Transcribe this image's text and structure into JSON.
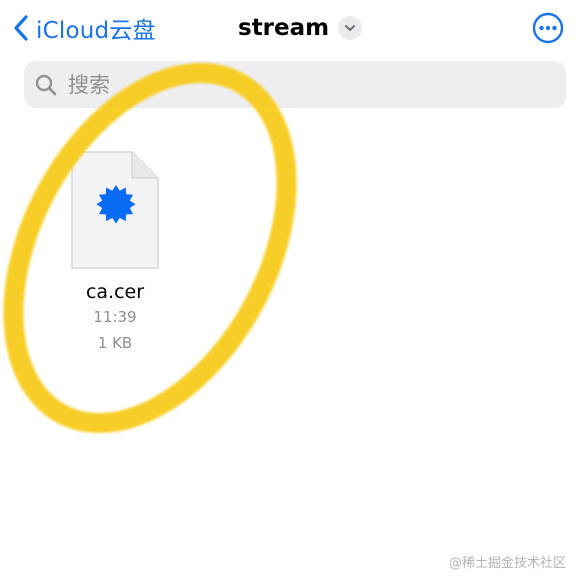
{
  "nav": {
    "back_label": "iCloud云盘",
    "title": "stream",
    "back_icon": "chevron-left-icon",
    "title_menu_icon": "chevron-down-icon",
    "more_icon": "ellipsis-circle-icon"
  },
  "search": {
    "placeholder": "搜索",
    "value": "",
    "icon": "search-icon"
  },
  "files": [
    {
      "name": "ca.cer",
      "time": "11:39",
      "size": "1 KB",
      "icon": "certificate-seal-icon"
    }
  ],
  "watermark": "@稀土掘金技术社区",
  "colors": {
    "accent": "#1a73e8",
    "seal": "#0a6cf5",
    "highlight": "#f7cc1a",
    "secondary_text": "#8e8e93",
    "search_bg": "#eeeef0"
  }
}
